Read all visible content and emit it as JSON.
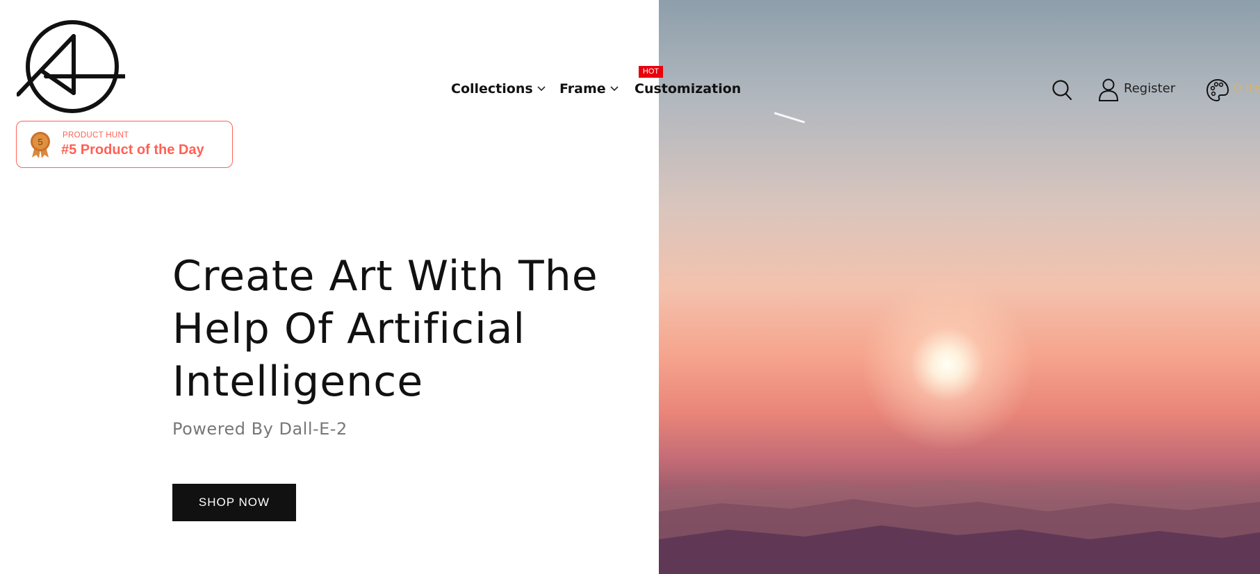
{
  "logo": {
    "icon": "ai-circle-logo-icon"
  },
  "product_hunt": {
    "small_label": "PRODUCT HUNT",
    "big_label": "#5 Product of the Day",
    "rank": "5",
    "color": "#ff6154"
  },
  "nav": {
    "items": [
      {
        "label": "Collections",
        "has_dropdown": true
      },
      {
        "label": "Frame",
        "has_dropdown": true
      },
      {
        "label": "Customization",
        "has_dropdown": false,
        "badge": "HOT"
      }
    ]
  },
  "header": {
    "search_icon": "search-icon",
    "user_icon": "user-icon",
    "register_label": "Register",
    "cart_icon": "palette-icon",
    "cart_count": "0 ite"
  },
  "hero": {
    "title": "Create Art With The Help Of Artificial Intelligence",
    "subtitle": "Powered By Dall-E-2",
    "cta_label": "SHOP NOW"
  },
  "colors": {
    "hot_badge": "#e8000b",
    "cart_text": "#d7b46a",
    "button_bg": "#111111"
  }
}
